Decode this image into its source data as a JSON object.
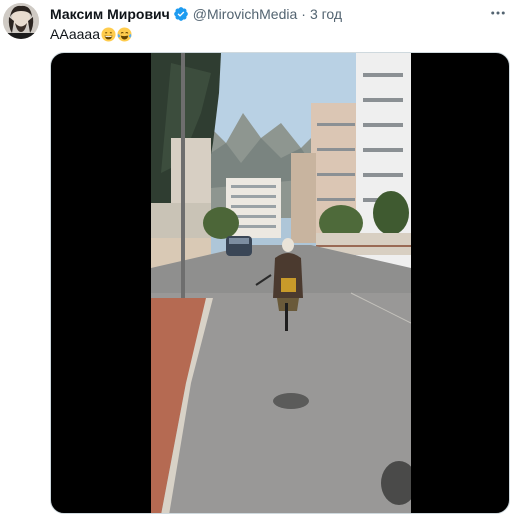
{
  "author": {
    "display_name": "Максим Мирович",
    "handle": "@MirovichMedia",
    "separator": "·",
    "time": "3 год",
    "verified": true
  },
  "tweet": {
    "text": "ААаааа",
    "emojis": [
      "grinning-face-with-smiling-eyes",
      "face-with-tears-of-joy"
    ]
  },
  "media": {
    "type": "video",
    "description_icon": "video-frame"
  },
  "colors": {
    "name": "#0f1419",
    "secondary": "#536471",
    "verified": "#1d9bf0",
    "media_bg": "#000000"
  }
}
